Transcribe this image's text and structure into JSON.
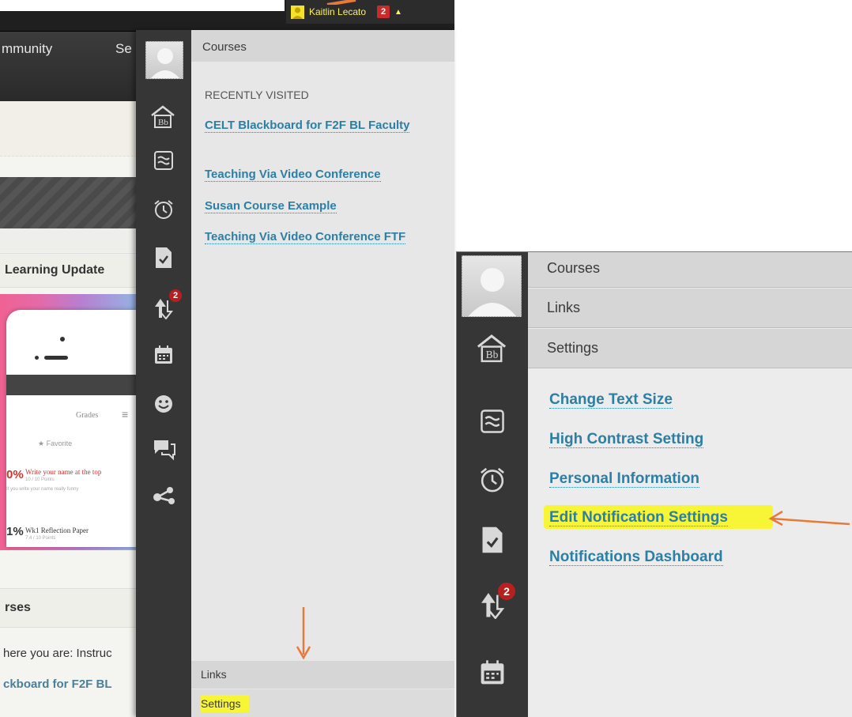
{
  "user_menu": {
    "name": "Kaitlin Lecato",
    "badge": "2"
  },
  "nav": {
    "community": "mmunity",
    "services": "Se"
  },
  "background": {
    "module_title": "Learning Update",
    "phone": {
      "grades": "Grades",
      "favorite": "Favorite",
      "row1_pct": "0%",
      "row1_title": "Write your name at the top",
      "row1_sub": "10 / 10 Points",
      "row1_note": "If you write your name really funny",
      "row2_pct": "1%",
      "row2_title": "Wk1 Reflection Paper",
      "row2_sub": "7.4 / 10 Points"
    },
    "courses_title": "rses",
    "here_text": "here you are: Instruc",
    "course_link": "ckboard for F2F BL"
  },
  "left_panel": {
    "courses_header": "Courses",
    "recently_visited_label": "RECENTLY VISITED",
    "recent_courses": [
      "CELT Blackboard for F2F BL Faculty",
      "Teaching Via Video Conference",
      "Susan Course Example",
      "Teaching Via Video Conference FTF"
    ],
    "links_header": "Links",
    "settings_header": "Settings",
    "rail_badge": "2"
  },
  "right_panel": {
    "headers": [
      "Courses",
      "Links",
      "Settings"
    ],
    "settings_links": [
      "Change Text Size",
      "High Contrast Setting",
      "Personal Information",
      "Edit Notification Settings",
      "Notifications Dashboard"
    ],
    "rail_badge": "2"
  },
  "colors": {
    "link": "#2c7fa4",
    "highlight": "#f8f536",
    "annotation_arrow": "#e8793a",
    "rail": "#363636",
    "badge": "#b82020"
  }
}
